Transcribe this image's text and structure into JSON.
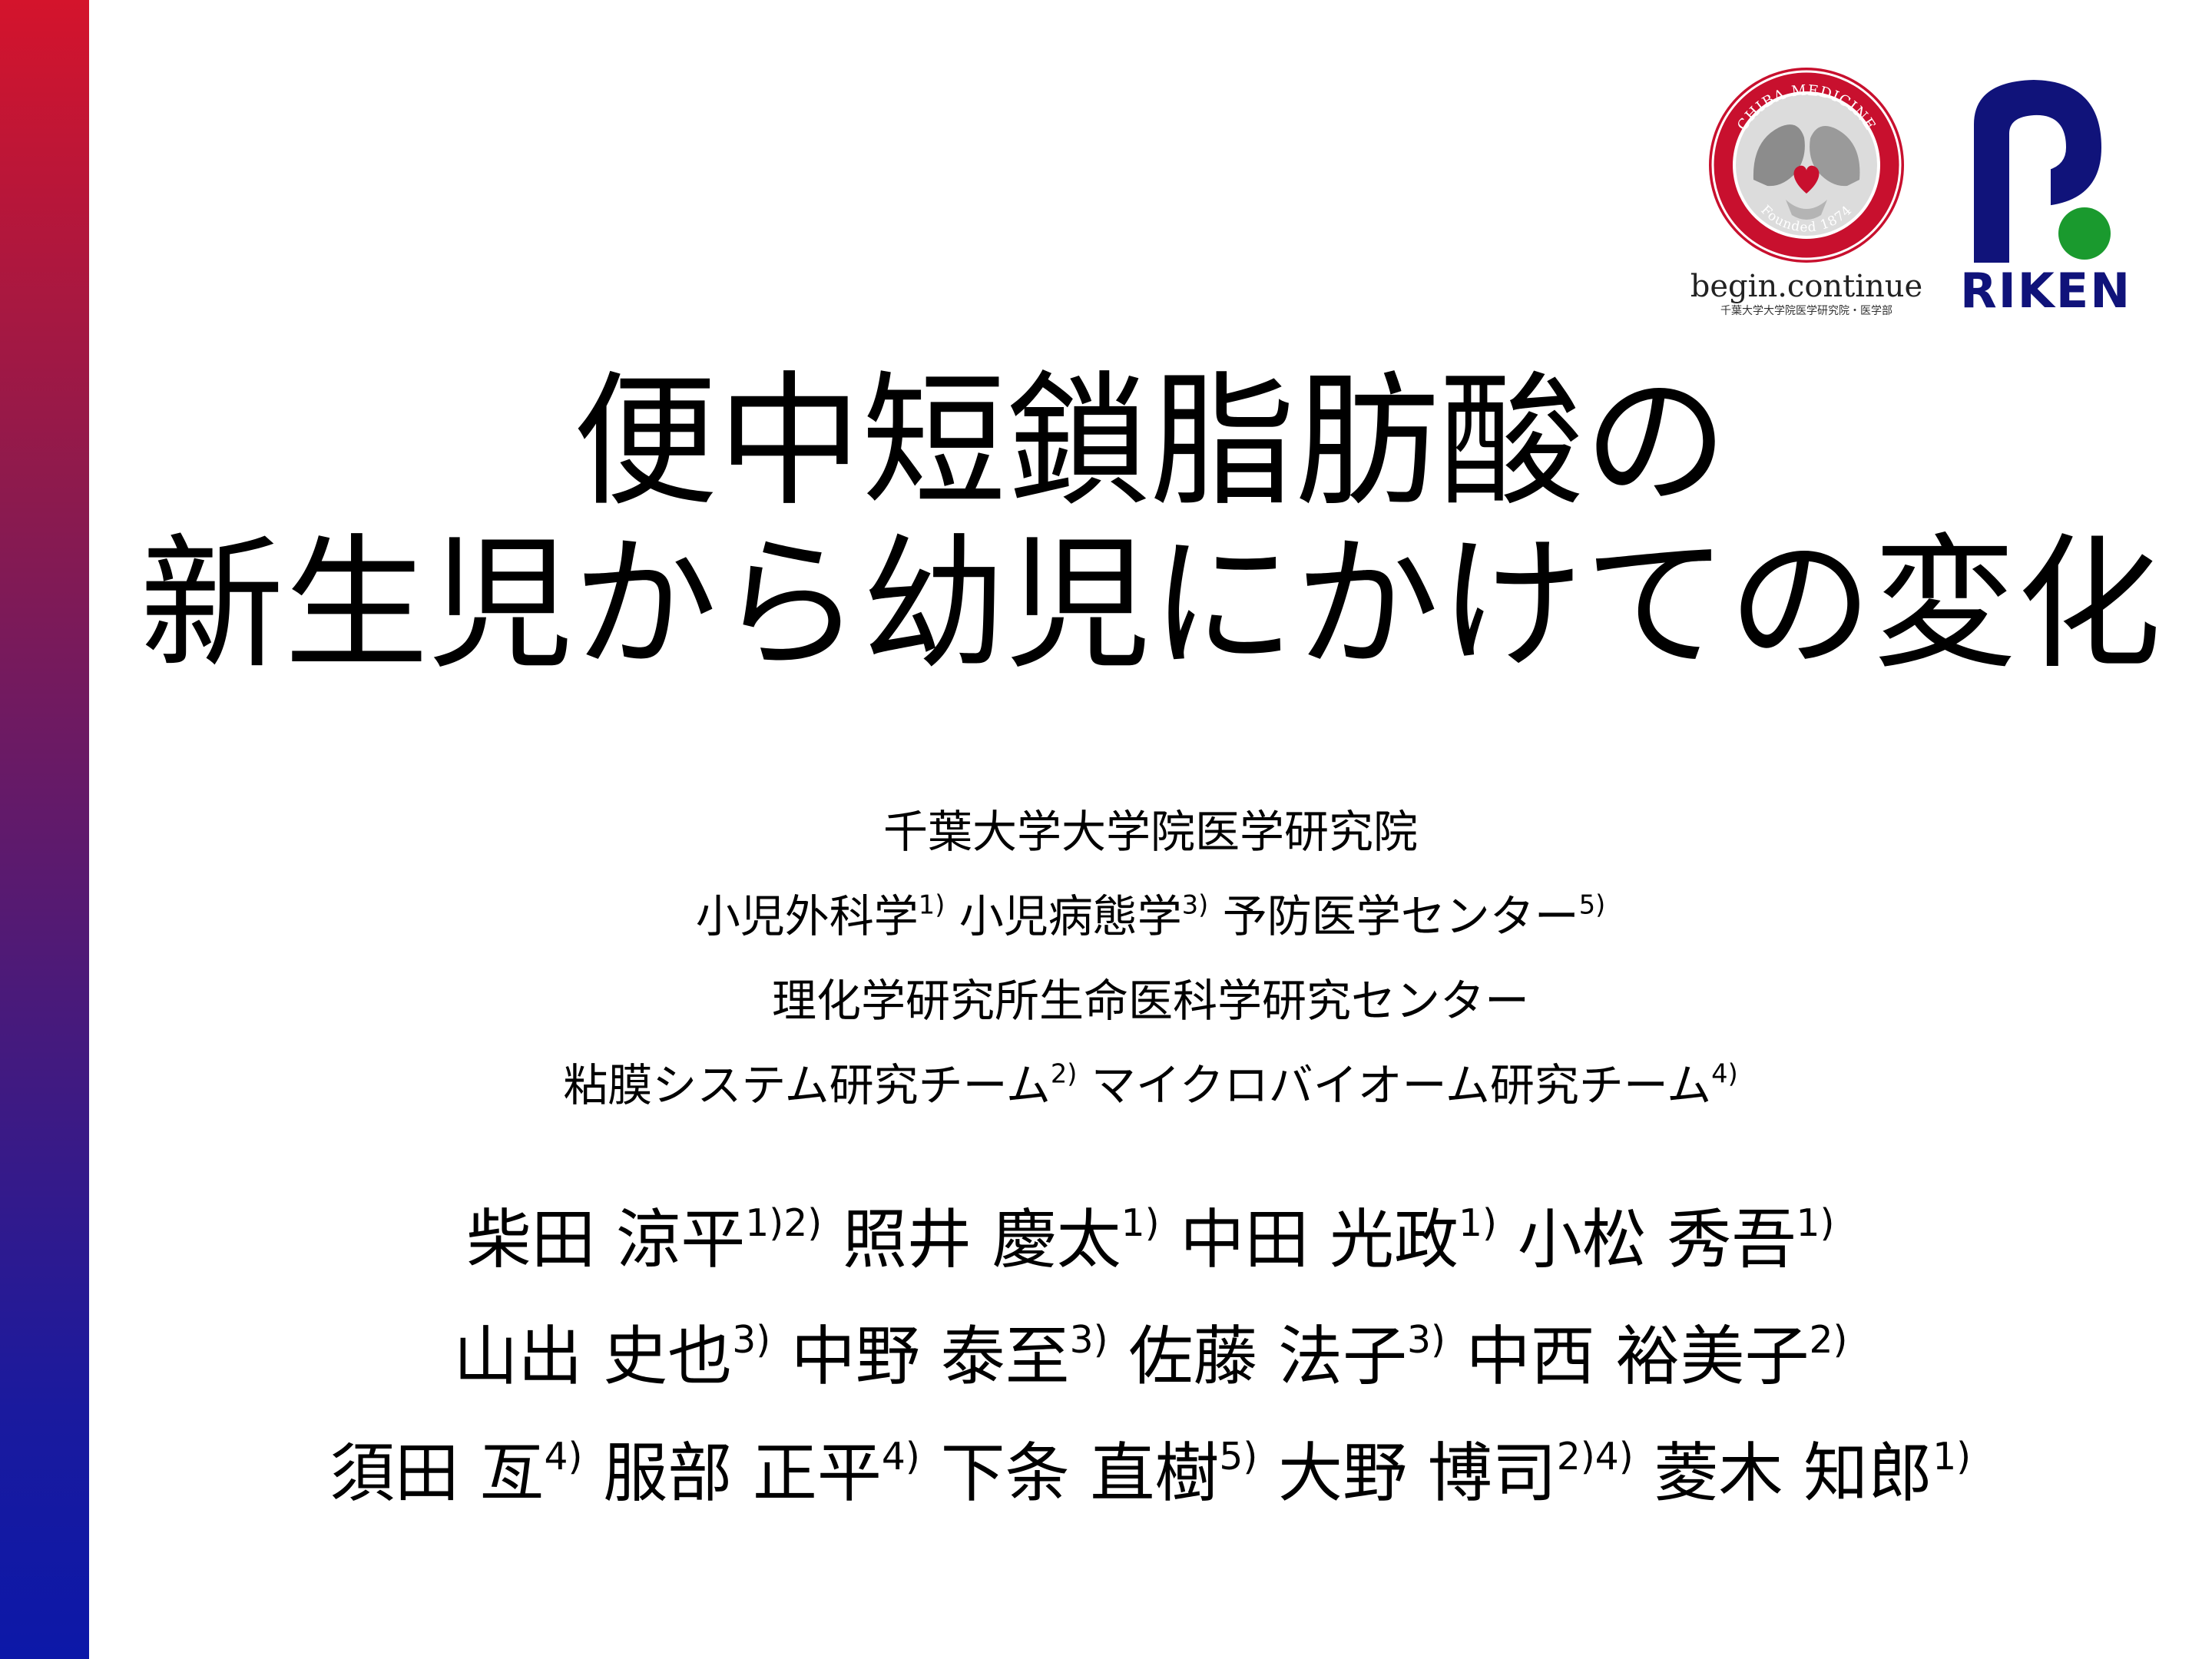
{
  "title": {
    "line1": "便中短鎖脂肪酸の",
    "line2": "新生児から幼児にかけての変化"
  },
  "logos": {
    "chiba": {
      "ring_text_top": "CHIBA MEDICINE",
      "ring_text_bottom": "Founded 1874",
      "tagline": "begin.continue",
      "subtext": "千葉大学大学院医学研究院・医学部",
      "ring_color": "#c8102e"
    },
    "riken": {
      "wordmark": "RIKEN",
      "mark_color": "#10137a",
      "dot_color": "#1a9a2e"
    }
  },
  "affiliations": [
    [
      {
        "t": "千葉大学大学院医学研究院"
      }
    ],
    [
      {
        "t": "小児外科学"
      },
      {
        "s": "1)"
      },
      {
        "t": " 小児病態学"
      },
      {
        "s": "3)"
      },
      {
        "t": " 予防医学センター"
      },
      {
        "s": "5)"
      }
    ],
    [
      {
        "t": "理化学研究所生命医科学研究センター"
      }
    ],
    [
      {
        "t": "粘膜システム研究チーム"
      },
      {
        "s": "2)"
      },
      {
        "t": " マイクロバイオーム研究チーム"
      },
      {
        "s": "4)"
      }
    ]
  ],
  "authors": [
    [
      {
        "t": "柴田 涼平"
      },
      {
        "s": "1)2)"
      },
      {
        "t": " 照井 慶太"
      },
      {
        "s": "1)"
      },
      {
        "t": " 中田 光政"
      },
      {
        "s": "1)"
      },
      {
        "t": " 小松 秀吾"
      },
      {
        "s": "1)"
      }
    ],
    [
      {
        "t": "山出 史也"
      },
      {
        "s": "3)"
      },
      {
        "t": " 中野 泰至"
      },
      {
        "s": "3)"
      },
      {
        "t": " 佐藤 法子"
      },
      {
        "s": "3)"
      },
      {
        "t": " 中西 裕美子"
      },
      {
        "s": "2)"
      }
    ],
    [
      {
        "t": "須田 亙"
      },
      {
        "s": "4)"
      },
      {
        "t": " 服部 正平"
      },
      {
        "s": "4)"
      },
      {
        "t": " 下条 直樹"
      },
      {
        "s": "5)"
      },
      {
        "t": " 大野 博司"
      },
      {
        "s": "2)4)"
      },
      {
        "t": " 菱木 知郎"
      },
      {
        "s": "1)"
      }
    ]
  ],
  "colors": {
    "bar_top": "#d4142c",
    "bar_bottom": "#0c18a8"
  }
}
